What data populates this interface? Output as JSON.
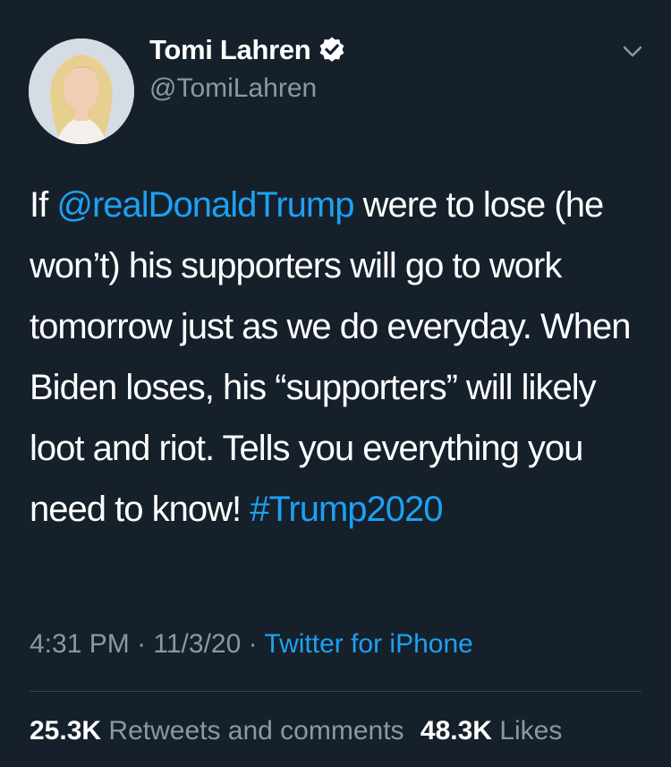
{
  "author": {
    "display_name": "Tomi Lahren",
    "handle": "@TomiLahren",
    "verified": true
  },
  "tweet": {
    "prefix": "If ",
    "mention": "@realDonaldTrump",
    "body": " were to lose (he won’t) his supporters will go to work tomorrow just as we do everyday. When Biden loses, his “supporters” will likely loot and riot. Tells you everything you need to know! ",
    "hashtag": "#Trump2020"
  },
  "meta": {
    "time": "4:31 PM",
    "separator": " · ",
    "date": "11/3/20",
    "source": "Twitter for iPhone"
  },
  "stats": {
    "retweets_count": "25.3K",
    "retweets_label": "Retweets and comments",
    "likes_count": "48.3K",
    "likes_label": "Likes"
  },
  "colors": {
    "background": "#15202b",
    "link": "#1da1f2",
    "secondary": "#8899a6",
    "divider": "#38444d"
  },
  "icons": [
    "avatar",
    "verified-badge-icon",
    "chevron-down-icon"
  ]
}
